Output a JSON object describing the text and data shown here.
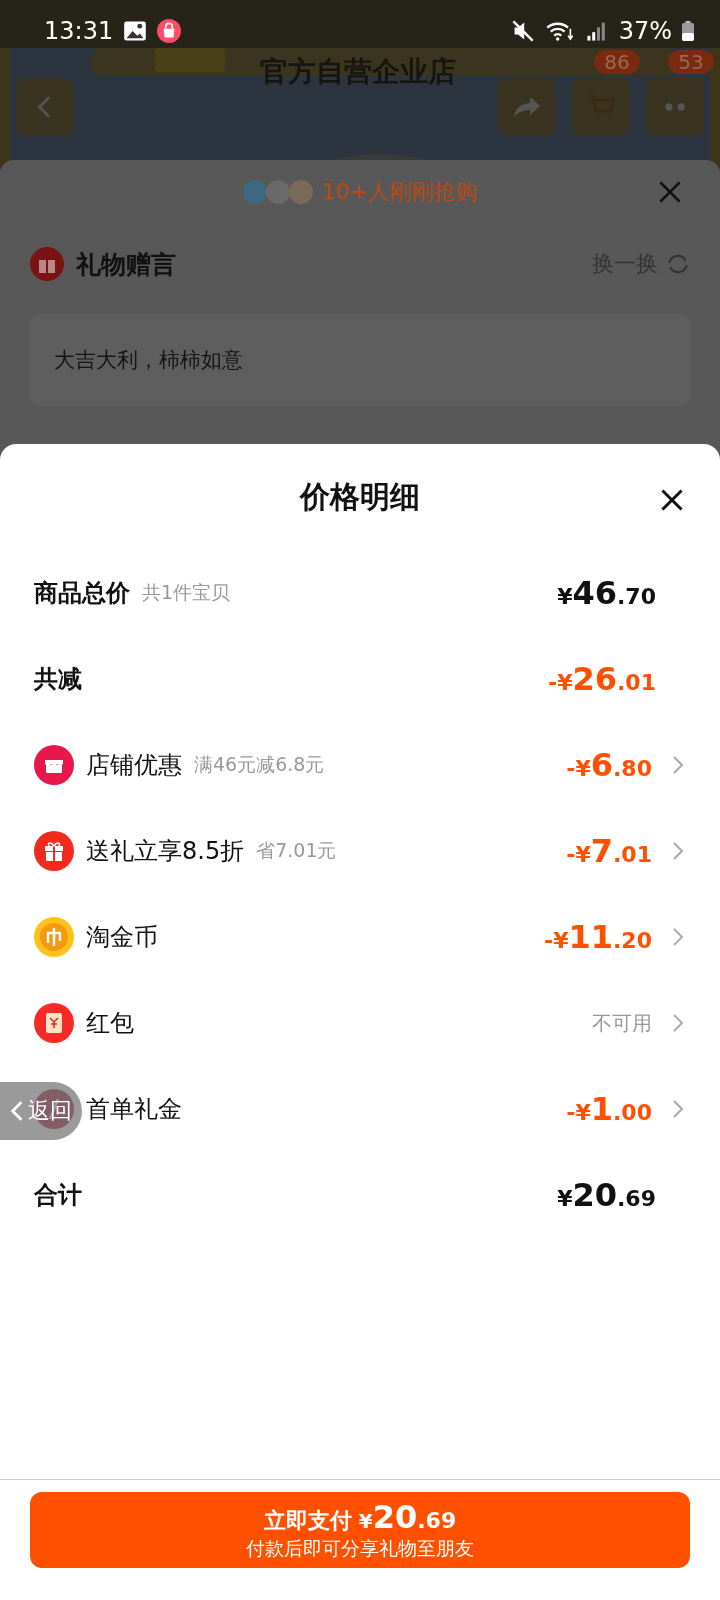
{
  "status_bar": {
    "time": "13:31",
    "battery": "37%"
  },
  "background_page": {
    "store_title": "官方自营企业店",
    "cart_badge": "86",
    "message_badge": "53",
    "buyers_note": "10+人刚刚抢购",
    "gift_message": {
      "title": "礼物赠言",
      "refresh": "换一换",
      "text": "大吉大利，柿柿如意"
    }
  },
  "price_sheet": {
    "title": "价格明细",
    "rows": [
      {
        "kind": "summary",
        "label": "商品总价",
        "note": "共1件宝贝",
        "amount": "¥46.70",
        "discount": false,
        "available": true
      },
      {
        "kind": "summary",
        "label": "共减",
        "amount": "-¥26.01",
        "discount": true,
        "available": true
      },
      {
        "kind": "item",
        "label": "店铺优惠",
        "note": "满46元减6.8元",
        "amount": "-¥6.80",
        "discount": true,
        "available": true
      },
      {
        "kind": "item",
        "label": "送礼立享8.5折",
        "note": "省7.01元",
        "amount": "-¥7.01",
        "discount": true,
        "available": true
      },
      {
        "kind": "item",
        "label": "淘金币",
        "amount": "-¥11.20",
        "discount": true,
        "available": true
      },
      {
        "kind": "item",
        "label": "红包",
        "amount": "不可用",
        "available": false
      },
      {
        "kind": "item",
        "label": "首单礼金",
        "amount": "-¥1.00",
        "discount": true,
        "available": true
      },
      {
        "kind": "summary",
        "label": "合计",
        "amount": "¥20.69",
        "discount": false,
        "available": true
      }
    ],
    "pay_button": {
      "label": "立即支付",
      "amount": "¥20.69",
      "note": "付款后即可分享礼物至朋友"
    }
  },
  "back_gesture": {
    "label": "返回"
  }
}
